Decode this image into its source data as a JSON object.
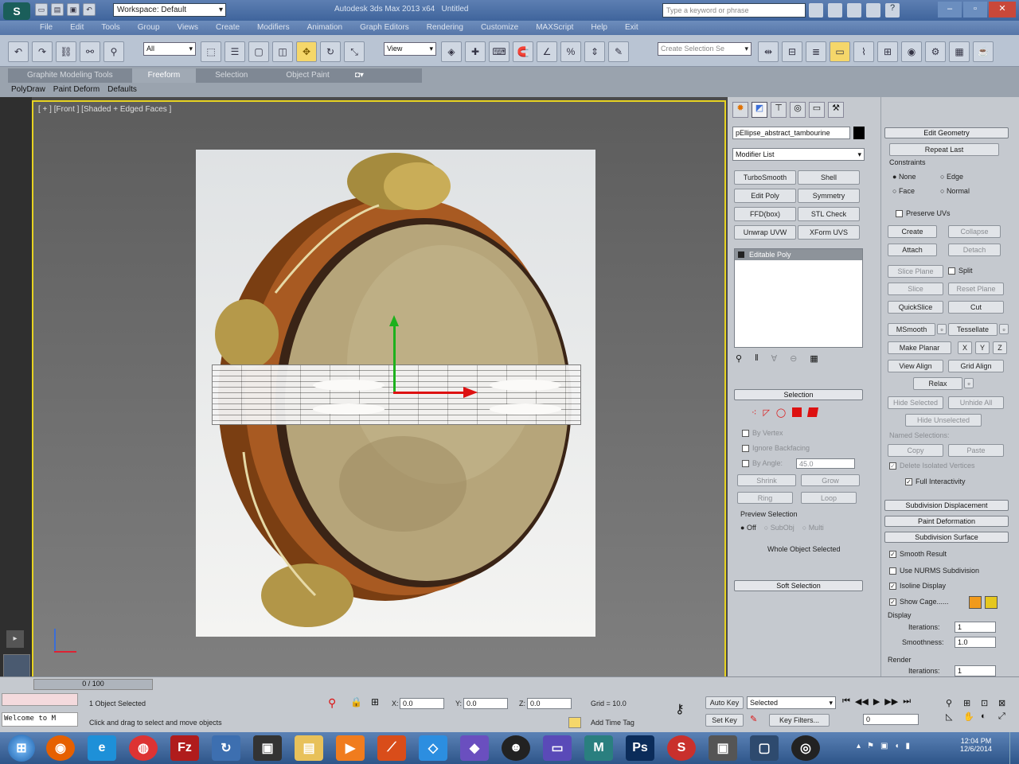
{
  "title": {
    "workspace": "Workspace: Default",
    "app_title": "Autodesk 3ds Max 2013 x64",
    "doc": "Untitled",
    "search_placeholder": "Type a keyword or phrase"
  },
  "menu": [
    "File",
    "Edit",
    "Tools",
    "Group",
    "Views",
    "Create",
    "Modifiers",
    "Animation",
    "Graph Editors",
    "Rendering",
    "Customize",
    "MAXScript",
    "Help",
    "Exit"
  ],
  "toolbar": {
    "filter": "All",
    "view": "View",
    "selection_set": "Create Selection Se"
  },
  "ribbon": {
    "tabs": [
      "Graphite Modeling Tools",
      "Freeform",
      "Selection",
      "Object Paint"
    ],
    "subtabs": [
      "PolyDraw",
      "Paint Deform",
      "Defaults"
    ]
  },
  "viewport": {
    "label": "[ + ] [Front ] [Shaded + Edged Faces ]"
  },
  "cmd": {
    "object_name": "pEllipse_abstract_tambourine",
    "modifier_list": "Modifier List",
    "modifier_buttons": [
      "TurboSmooth",
      "Shell",
      "Edit Poly",
      "Symmetry",
      "FFD(box)",
      "STL Check",
      "Unwrap UVW",
      "XForm UVS"
    ],
    "stack_item": "Editable Poly",
    "selection_header": "Selection",
    "sel_opts": [
      "By Vertex",
      "Ignore Backfacing",
      "By Angle:"
    ],
    "angle": "45.0",
    "shrink": "Shrink",
    "grow": "Grow",
    "ring": "Ring",
    "loop": "Loop",
    "preview_label": "Preview Selection",
    "preview_opts": [
      "Off",
      "SubObj",
      "Multi"
    ],
    "whole_obj": "Whole Object Selected",
    "soft_sel": "Soft Selection"
  },
  "edit": {
    "header": "Edit Geometry",
    "repeat": "Repeat Last",
    "constraints": "Constraints",
    "cons_opts": [
      "None",
      "Edge",
      "Face",
      "Normal"
    ],
    "preserve": "Preserve UVs",
    "create": "Create",
    "collapse": "Collapse",
    "attach": "Attach",
    "detach": "Detach",
    "slice_plane": "Slice Plane",
    "split": "Split",
    "slice": "Slice",
    "reset_plane": "Reset Plane",
    "quickslice": "QuickSlice",
    "cut": "Cut",
    "msmooth": "MSmooth",
    "tessellate": "Tessellate",
    "make_planar": "Make Planar",
    "xyz": [
      "X",
      "Y",
      "Z"
    ],
    "view_align": "View Align",
    "grid_align": "Grid Align",
    "relax": "Relax",
    "hide_sel": "Hide Selected",
    "unhide_all": "Unhide All",
    "hide_unsel": "Hide Unselected",
    "named_sel": "Named Selections:",
    "copy": "Copy",
    "paste": "Paste",
    "del_iso": "Delete Isolated Vertices",
    "full_inter": "Full Interactivity",
    "subdiv_disp": "Subdivision Displacement",
    "paint_def": "Paint Deformation",
    "subdiv_surf": "Subdivision Surface",
    "smooth_result": "Smooth Result",
    "nurms": "Use NURMS Subdivision",
    "isoline": "Isoline Display",
    "show_cage": "Show Cage......",
    "display": "Display",
    "iterations": "Iterations:",
    "smoothness": "Smoothness:",
    "iter_val": "1",
    "smooth_val": "1.0",
    "render": "Render",
    "iter_val2": "1",
    "cage_colors": [
      "#f19a1c",
      "#e6c71e"
    ]
  },
  "status": {
    "frame": "0 / 100",
    "objects": "1 Object Selected",
    "prompt": "Click and drag to select and move objects",
    "welcome": "Welcome to M",
    "x": "0.0",
    "y": "0.0",
    "z": "0.0",
    "grid": "Grid = 10.0",
    "autokey": "Auto Key",
    "setkey": "Set Key",
    "selected": "Selected",
    "key_filters": "Key Filters...",
    "add_time_tag": "Add Time Tag",
    "frame_field": "0"
  },
  "taskbar": {
    "time": "12:04 PM",
    "date": "12/6/2014",
    "apps": [
      "firefox",
      "ie",
      "chrome",
      "filezilla",
      "app5",
      "app6",
      "explorer",
      "media",
      "app9",
      "dropbox",
      "app11",
      "app12",
      "app13",
      "maya",
      "photoshop",
      "app16",
      "app17",
      "app18",
      "app19"
    ]
  }
}
